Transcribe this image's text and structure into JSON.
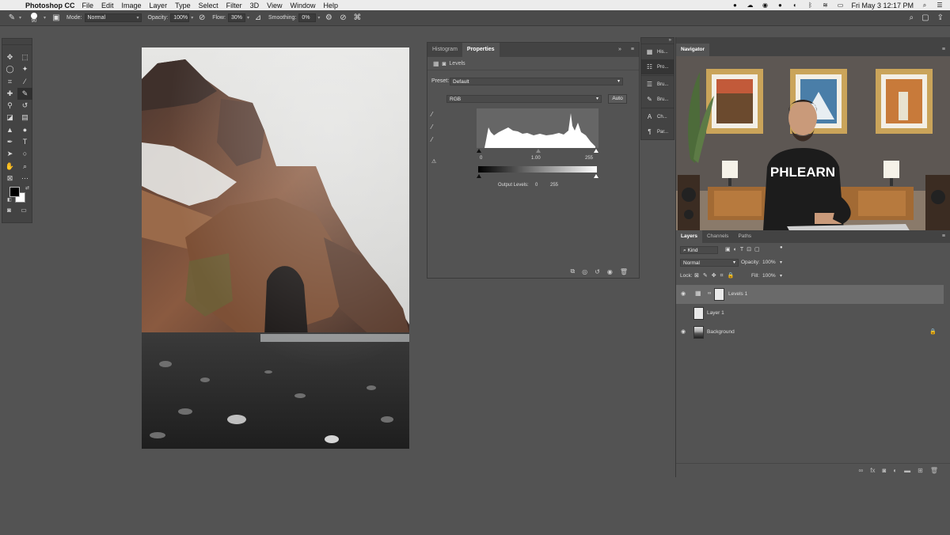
{
  "menubar": {
    "app_name": "Photoshop CC",
    "items": [
      "File",
      "Edit",
      "Image",
      "Layer",
      "Type",
      "Select",
      "Filter",
      "3D",
      "View",
      "Window",
      "Help"
    ],
    "clock": "Fri May 3  12:17 PM",
    "icons": [
      "apple-icon",
      "wifi-icon",
      "search-icon",
      "list-icon"
    ]
  },
  "options": {
    "brush_size": "90",
    "mode_label": "Mode:",
    "mode_value": "Normal",
    "opacity_label": "Opacity:",
    "opacity_value": "100%",
    "flow_label": "Flow:",
    "flow_value": "30%",
    "smoothing_label": "Smoothing:",
    "smoothing_value": "0%"
  },
  "properties": {
    "tabs": [
      {
        "label": "Histogram",
        "active": false
      },
      {
        "label": "Properties",
        "active": true
      }
    ],
    "header": "Levels",
    "preset_label": "Preset:",
    "preset_value": "Default",
    "channel_value": "RGB",
    "auto_label": "Auto",
    "input_black": "0",
    "input_gamma": "1.00",
    "input_white": "255",
    "output_label": "Output Levels:",
    "output_black": "0",
    "output_white": "255"
  },
  "strip": {
    "items": [
      {
        "label": "His...",
        "icon": "histogram-icon",
        "active": false
      },
      {
        "label": "Pro...",
        "icon": "properties-icon",
        "active": true
      },
      {
        "label": "Bru...",
        "icon": "brush-settings-icon",
        "active": false
      },
      {
        "label": "Bru...",
        "icon": "brush-icon",
        "active": false
      },
      {
        "label": "Ch...",
        "icon": "character-icon",
        "active": false
      },
      {
        "label": "Par...",
        "icon": "paragraph-icon",
        "active": false
      }
    ]
  },
  "navigator": {
    "tab": "Navigator",
    "shirt_text": "PHLEARN"
  },
  "layers": {
    "tabs": [
      {
        "label": "Layers",
        "active": true
      },
      {
        "label": "Channels",
        "active": false
      },
      {
        "label": "Paths",
        "active": false
      }
    ],
    "kind_label": "Kind",
    "blend_mode": "Normal",
    "opacity_label": "Opacity:",
    "opacity_value": "100%",
    "lock_label": "Lock:",
    "fill_label": "Fill:",
    "fill_value": "100%",
    "list": [
      {
        "name": "Levels 1",
        "visible": true,
        "active": true,
        "type": "adjustment"
      },
      {
        "name": "Layer 1",
        "visible": false,
        "active": false,
        "type": "pixel"
      },
      {
        "name": "Background",
        "visible": true,
        "active": false,
        "type": "background"
      }
    ]
  }
}
